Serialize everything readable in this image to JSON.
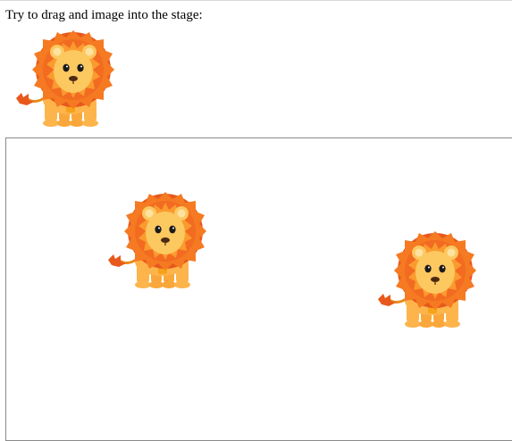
{
  "page": {
    "instructions": "Try to drag and image into the stage:"
  },
  "source_image": {
    "icon": "lion-icon",
    "alt": "lion"
  },
  "stage": {
    "images": [
      {
        "icon": "lion-icon",
        "alt": "lion"
      },
      {
        "icon": "lion-icon",
        "alt": "lion"
      }
    ]
  },
  "colors": {
    "mane_dark": "#e8581c",
    "mane_mid": "#f57a22",
    "mane_light": "#fbb03b",
    "body": "#fdb44b",
    "face": "#fcc860",
    "ear_inner": "#fde2a0",
    "nose": "#4a2a10",
    "stage_border": "#8a8a8a"
  }
}
